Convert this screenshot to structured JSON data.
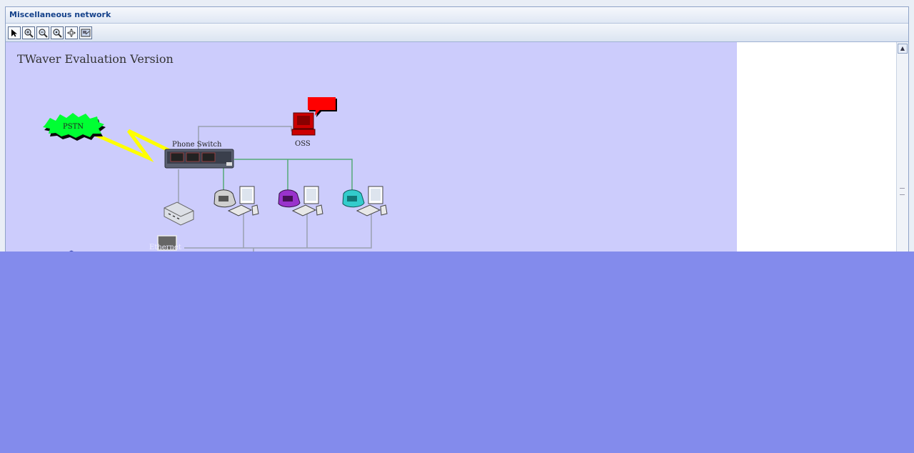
{
  "window": {
    "title": "Miscellaneous network"
  },
  "toolbar": {
    "buttons": [
      {
        "name": "select-tool-button",
        "icon": "pointer-icon"
      },
      {
        "name": "zoom-in-button",
        "icon": "zoom-in-icon"
      },
      {
        "name": "zoom-out-button",
        "icon": "zoom-out-icon"
      },
      {
        "name": "zoom-reset-button",
        "icon": "zoom-reset-icon"
      },
      {
        "name": "fit-to-window-button",
        "icon": "fit-icon"
      },
      {
        "name": "overview-button",
        "icon": "overview-icon"
      }
    ]
  },
  "canvas": {
    "watermark": "TWaver Evaluation Version",
    "nodes": {
      "pstn": "PSTN",
      "phone_switch": "Phone Switch",
      "oss": "OSS",
      "ethernet": "Ethernet"
    }
  },
  "colors": {
    "canvas_bg": "#ccccfc",
    "overlay": "#838bec",
    "pstn_cloud": "#00ff33",
    "oss_alert": "#ff0000",
    "phone_purple": "#9933cc",
    "phone_teal": "#33cccc",
    "link_yellow": "#ffff00",
    "link_green": "#55aa77"
  }
}
